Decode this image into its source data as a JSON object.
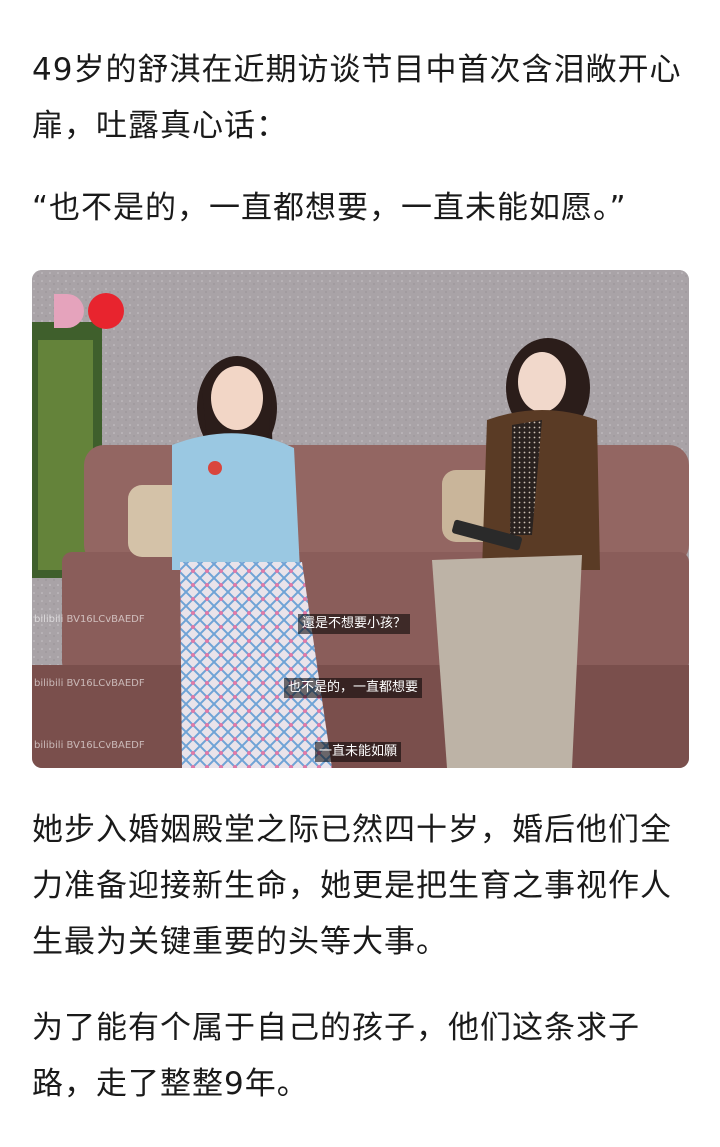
{
  "paragraphs": {
    "p1": "49岁的舒淇在近期访谈节目中首次含泪敞开心扉，吐露真心话：",
    "p2": "“也不是的，一直都想要，一直未能如愿。”",
    "p3": "她步入婚姻殿堂之际已然四十岁，婚后他们全力准备迎接新生命，她更是把生育之事视作人生最为关键重要的头等大事。",
    "p4": "为了能有个属于自己的孩子，他们这条求子路，走了整整9年。"
  },
  "photo": {
    "subtitles": [
      "還是不想要小孩？",
      "也不是的，一直都想要",
      "一直未能如願"
    ],
    "watermark": "bilibili BV16LCvBAEDF",
    "colors": {
      "wall": "#a69fa4",
      "sofa": "#8a5d5a",
      "logo_pink": "#e5a3bc",
      "logo_red": "#e8242e"
    }
  }
}
